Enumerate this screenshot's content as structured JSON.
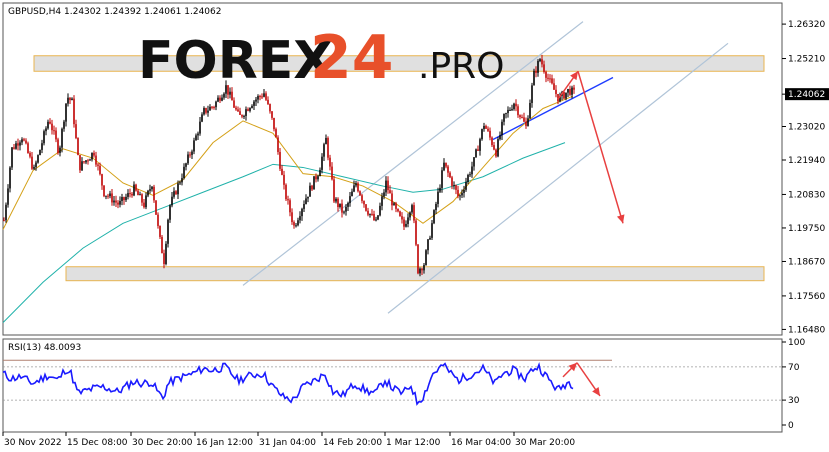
{
  "header": {
    "symbol_line": "GBPUSD,H4  1.24302 1.24392 1.24061 1.24062"
  },
  "watermark": {
    "forex": "FOREX",
    "number": "24",
    "suffix": ".PRO"
  },
  "indicator": {
    "label": "RSI(13) 48.0093"
  },
  "colors": {
    "bull_candle": "#000000",
    "bear_candle": "#c00000",
    "ma_fast": "#d4a017",
    "ma_slow": "#20b2aa",
    "channel": "#b0c4d8",
    "trendline": "#1e3cff",
    "arrow": "#e84040",
    "zone_fill": "#e0e0e0",
    "zone_border": "#e8b450",
    "rsi_line": "#1a1aff",
    "price_tag_bg": "#000000",
    "watermark_dark": "#111111",
    "watermark_accent": "#e8502a"
  },
  "chart_data": [
    {
      "type": "candlestick",
      "title": "GBPUSD,H4  1.24302 1.24392 1.24061 1.24062",
      "current_price": "1.24062",
      "y_ticks": [
        "1.26320",
        "1.25210",
        "1.24062",
        "1.23020",
        "1.21940",
        "1.20830",
        "1.19750",
        "1.18670",
        "1.17560",
        "1.16480"
      ],
      "ylim": [
        1.163,
        1.27
      ],
      "x_ticks": [
        "30 Nov 2022",
        "15 Dec 08:00",
        "30 Dec 20:00",
        "16 Jan 12:00",
        "31 Jan 04:00",
        "14 Feb 20:00",
        "1 Mar 12:00",
        "16 Mar 04:00",
        "30 Mar 20:00"
      ],
      "price_path": [
        [
          0,
          1.2
        ],
        [
          8,
          1.223
        ],
        [
          18,
          1.227
        ],
        [
          30,
          1.216
        ],
        [
          45,
          1.233
        ],
        [
          55,
          1.222
        ],
        [
          63,
          1.24
        ],
        [
          68,
          1.238
        ],
        [
          75,
          1.217
        ],
        [
          90,
          1.222
        ],
        [
          100,
          1.209
        ],
        [
          115,
          1.205
        ],
        [
          130,
          1.21
        ],
        [
          140,
          1.205
        ],
        [
          148,
          1.212
        ],
        [
          155,
          1.195
        ],
        [
          160,
          1.187
        ],
        [
          165,
          1.204
        ],
        [
          175,
          1.212
        ],
        [
          190,
          1.225
        ],
        [
          200,
          1.235
        ],
        [
          210,
          1.237
        ],
        [
          222,
          1.243
        ],
        [
          235,
          1.233
        ],
        [
          248,
          1.238
        ],
        [
          260,
          1.241
        ],
        [
          270,
          1.23
        ],
        [
          280,
          1.21
        ],
        [
          290,
          1.198
        ],
        [
          300,
          1.206
        ],
        [
          315,
          1.216
        ],
        [
          322,
          1.226
        ],
        [
          330,
          1.207
        ],
        [
          340,
          1.202
        ],
        [
          352,
          1.212
        ],
        [
          362,
          1.204
        ],
        [
          372,
          1.199
        ],
        [
          382,
          1.212
        ],
        [
          390,
          1.204
        ],
        [
          400,
          1.198
        ],
        [
          408,
          1.206
        ],
        [
          414,
          1.184
        ],
        [
          420,
          1.186
        ],
        [
          430,
          1.202
        ],
        [
          440,
          1.218
        ],
        [
          455,
          1.207
        ],
        [
          470,
          1.219
        ],
        [
          480,
          1.231
        ],
        [
          492,
          1.222
        ],
        [
          500,
          1.233
        ],
        [
          510,
          1.238
        ],
        [
          522,
          1.23
        ],
        [
          530,
          1.247
        ],
        [
          536,
          1.252
        ],
        [
          545,
          1.245
        ],
        [
          555,
          1.239
        ],
        [
          565,
          1.242
        ],
        [
          571,
          1.2406
        ]
      ],
      "ma_fast_path": [
        [
          0,
          1.197
        ],
        [
          30,
          1.216
        ],
        [
          60,
          1.223
        ],
        [
          90,
          1.22
        ],
        [
          120,
          1.212
        ],
        [
          150,
          1.208
        ],
        [
          180,
          1.213
        ],
        [
          210,
          1.225
        ],
        [
          240,
          1.232
        ],
        [
          270,
          1.228
        ],
        [
          300,
          1.215
        ],
        [
          330,
          1.214
        ],
        [
          360,
          1.211
        ],
        [
          390,
          1.206
        ],
        [
          420,
          1.199
        ],
        [
          450,
          1.206
        ],
        [
          480,
          1.217
        ],
        [
          510,
          1.228
        ],
        [
          540,
          1.236
        ],
        [
          570,
          1.24
        ]
      ],
      "ma_slow_path": [
        [
          0,
          1.167
        ],
        [
          40,
          1.18
        ],
        [
          80,
          1.191
        ],
        [
          120,
          1.199
        ],
        [
          160,
          1.204
        ],
        [
          200,
          1.209
        ],
        [
          240,
          1.214
        ],
        [
          270,
          1.218
        ],
        [
          300,
          1.217
        ],
        [
          340,
          1.214
        ],
        [
          380,
          1.211
        ],
        [
          410,
          1.209
        ],
        [
          440,
          1.21
        ],
        [
          480,
          1.214
        ],
        [
          520,
          1.22
        ],
        [
          562,
          1.225
        ]
      ],
      "support_zone": [
        1.1805,
        1.185
      ],
      "resistance_zone": [
        1.248,
        1.253
      ],
      "upper_channel": [
        [
          240,
          1.179
        ],
        [
          580,
          1.264
        ]
      ],
      "lower_channel": [
        [
          385,
          1.17
        ],
        [
          725,
          1.257
        ]
      ],
      "trendline": [
        [
          490,
          1.226
        ],
        [
          610,
          1.246
        ]
      ],
      "forecast_path": [
        [
          555,
          1.239
        ],
        [
          575,
          1.248
        ],
        [
          620,
          1.199
        ]
      ]
    },
    {
      "type": "line",
      "title": "RSI(13) 48.0093",
      "y_ticks": [
        "100",
        "70",
        "30",
        "0"
      ],
      "ylim": [
        0,
        100
      ],
      "levels": [
        30,
        70
      ],
      "rsi_path": [
        [
          0,
          62
        ],
        [
          8,
          56
        ],
        [
          18,
          58
        ],
        [
          30,
          50
        ],
        [
          45,
          60
        ],
        [
          55,
          54
        ],
        [
          63,
          68
        ],
        [
          68,
          62
        ],
        [
          75,
          38
        ],
        [
          90,
          44
        ],
        [
          100,
          46
        ],
        [
          115,
          40
        ],
        [
          130,
          52
        ],
        [
          140,
          50
        ],
        [
          148,
          52
        ],
        [
          155,
          40
        ],
        [
          160,
          32
        ],
        [
          165,
          50
        ],
        [
          175,
          56
        ],
        [
          190,
          62
        ],
        [
          200,
          68
        ],
        [
          210,
          66
        ],
        [
          222,
          70
        ],
        [
          235,
          54
        ],
        [
          248,
          60
        ],
        [
          260,
          62
        ],
        [
          270,
          46
        ],
        [
          280,
          34
        ],
        [
          290,
          30
        ],
        [
          300,
          46
        ],
        [
          315,
          56
        ],
        [
          322,
          62
        ],
        [
          330,
          40
        ],
        [
          340,
          36
        ],
        [
          352,
          50
        ],
        [
          362,
          42
        ],
        [
          372,
          38
        ],
        [
          382,
          54
        ],
        [
          390,
          44
        ],
        [
          400,
          38
        ],
        [
          408,
          48
        ],
        [
          414,
          28
        ],
        [
          420,
          34
        ],
        [
          430,
          62
        ],
        [
          440,
          72
        ],
        [
          455,
          54
        ],
        [
          470,
          62
        ],
        [
          480,
          68
        ],
        [
          492,
          50
        ],
        [
          500,
          62
        ],
        [
          510,
          66
        ],
        [
          522,
          56
        ],
        [
          530,
          68
        ],
        [
          536,
          70
        ],
        [
          545,
          56
        ],
        [
          555,
          42
        ],
        [
          565,
          52
        ],
        [
          571,
          48
        ]
      ],
      "forecast_path": [
        [
          560,
          58
        ],
        [
          574,
          75
        ],
        [
          597,
          35
        ]
      ]
    }
  ]
}
